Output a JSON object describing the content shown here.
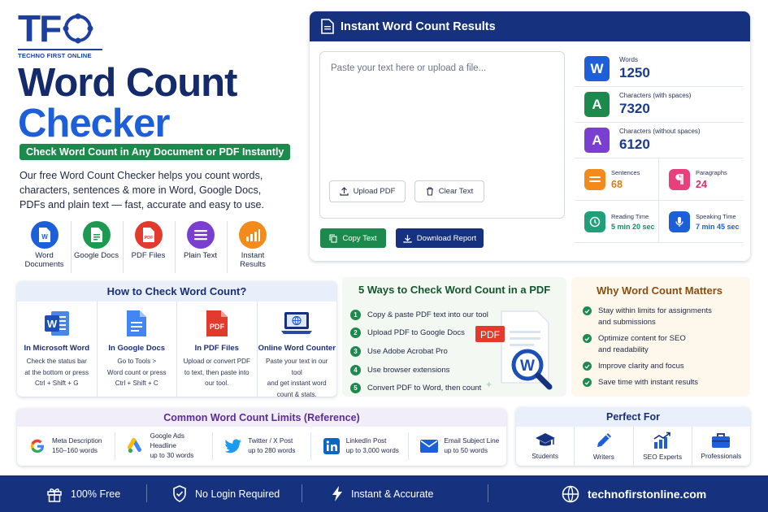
{
  "brand": {
    "logo_text_t": "T",
    "logo_text_f": "F",
    "tagline": "TECHNO FIRST ONLINE"
  },
  "hero": {
    "title_line1": "Word Count",
    "title_line2": "Checker",
    "badge": "Check Word Count in Any Document or PDF Instantly",
    "description": "Our free Word Count Checker helps you count words, characters, sentences & more in Word, Google Docs, PDFs and plain text — fast, accurate and easy to use.",
    "doc_types": [
      {
        "label": "Word Documents",
        "icon": "word-doc-icon",
        "color": "#1d5fd8"
      },
      {
        "label": "Google Docs",
        "icon": "google-docs-icon",
        "color": "#1c9a4f"
      },
      {
        "label": "PDF Files",
        "icon": "pdf-icon",
        "color": "#e23b2e"
      },
      {
        "label": "Plain Text",
        "icon": "text-lines-icon",
        "color": "#7a3fd0"
      },
      {
        "label": "Instant Results",
        "icon": "bar-chart-icon",
        "color": "#f28a1c"
      }
    ]
  },
  "results": {
    "title": "Instant Word Count Results",
    "textarea_placeholder": "Paste your text here or upload a file...",
    "upload_label": "Upload PDF",
    "clear_label": "Clear Text",
    "copy_label": "Copy Text",
    "download_label": "Download Report",
    "stats_big": [
      {
        "label": "Words",
        "value": "1250",
        "letter": "W",
        "color": "#1d5fd8"
      },
      {
        "label": "Characters (with spaces)",
        "value": "7320",
        "letter": "A",
        "color": "#1c8a4c"
      },
      {
        "label": "Characters (without spaces)",
        "value": "6120",
        "letter": "A",
        "color": "#7a3fd0"
      }
    ],
    "stats_small": [
      {
        "label": "Sentences",
        "value": "68",
        "color": "#f28a1c",
        "text_color": "#e07a10",
        "icon": "sentences-icon"
      },
      {
        "label": "Paragraphs",
        "value": "24",
        "color": "#e8407a",
        "text_color": "#d7306a",
        "icon": "paragraph-icon"
      },
      {
        "label": "Reading Time",
        "value": "5 min 20 sec",
        "color": "#1fa07a",
        "text_color": "#178a66",
        "icon": "clock-icon"
      },
      {
        "label": "Speaking Time",
        "value": "7 min 45 sec",
        "color": "#1d5fd8",
        "text_color": "#1d5fd8",
        "icon": "microphone-icon"
      }
    ]
  },
  "how": {
    "title": "How to Check Word Count?",
    "columns": [
      {
        "title": "In Microsoft Word",
        "lines": [
          "Check the status bar",
          "at the bottom or press",
          "Ctrl + Shift + G"
        ],
        "icon": "microsoft-word-icon"
      },
      {
        "title": "In Google Docs",
        "lines": [
          "Go to Tools >",
          "Word count or press",
          "Ctrl + Shift + C"
        ],
        "icon": "google-docs-icon"
      },
      {
        "title": "In PDF Files",
        "lines": [
          "Upload or convert PDF",
          "to text, then paste into",
          "our tool."
        ],
        "icon": "pdf-icon"
      },
      {
        "title": "Online Word Counter",
        "lines": [
          "Paste your text in our tool",
          "and get instant word",
          "count & stats."
        ],
        "icon": "laptop-globe-icon"
      }
    ]
  },
  "ways": {
    "title": "5 Ways to Check Word Count in a PDF",
    "items": [
      {
        "num": "1",
        "text": "Copy & paste PDF text into our tool"
      },
      {
        "num": "2",
        "text": "Upload PDF to Google Docs"
      },
      {
        "num": "3",
        "text": "Use Adobe Acrobat Pro"
      },
      {
        "num": "4",
        "text": "Use browser extensions"
      },
      {
        "num": "5",
        "text": "Convert PDF to Word, then count"
      }
    ],
    "illustration_pdf": "PDF",
    "illustration_w": "W"
  },
  "why": {
    "title": "Why Word Count Matters",
    "items": [
      {
        "line1": "Stay within limits for assignments",
        "line2": "and submissions"
      },
      {
        "line1": "Optimize content for SEO",
        "line2": "and readability"
      },
      {
        "line1": "Improve clarity and focus",
        "line2": ""
      },
      {
        "line1": "Save time with instant results",
        "line2": ""
      }
    ]
  },
  "limits": {
    "title": "Common Word Count Limits (Reference)",
    "items": [
      {
        "name": "Meta Description",
        "limit": "150–160 words",
        "icon": "google-g-icon"
      },
      {
        "name": "Google Ads Headline",
        "limit": "up to 30 words",
        "icon": "google-ads-icon"
      },
      {
        "name": "Twitter / X Post",
        "limit": "up to 280 words",
        "icon": "twitter-bird-icon"
      },
      {
        "name": "LinkedIn Post",
        "limit": "up to 3,000 words",
        "icon": "linkedin-icon"
      },
      {
        "name": "Email Subject Line",
        "limit": "up to 50 words",
        "icon": "envelope-icon"
      }
    ]
  },
  "perfect": {
    "title": "Perfect For",
    "items": [
      {
        "label": "Students",
        "icon": "graduation-cap-icon"
      },
      {
        "label": "Writers",
        "icon": "pen-icon"
      },
      {
        "label": "SEO Experts",
        "icon": "growth-chart-icon"
      },
      {
        "label": "Professionals",
        "icon": "briefcase-icon"
      }
    ]
  },
  "footer": {
    "items": [
      {
        "label": "100% Free",
        "icon": "gift-icon"
      },
      {
        "label": "No Login Required",
        "icon": "shield-check-icon"
      },
      {
        "label": "Instant & Accurate",
        "icon": "lightning-icon"
      }
    ],
    "url": "technofirstonline.com"
  },
  "colors": {
    "navy": "#16327e",
    "brand_blue": "#1c3fa0",
    "accent_blue": "#1d5fd8",
    "green": "#1c8a4c"
  }
}
